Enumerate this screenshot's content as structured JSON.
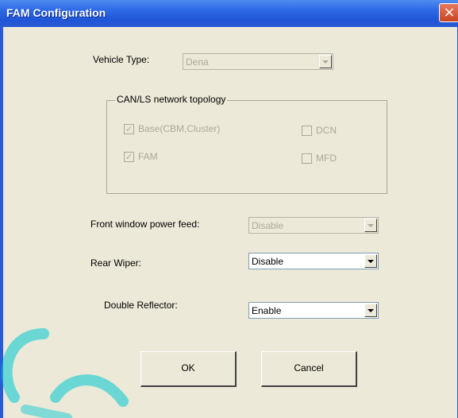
{
  "window": {
    "title": "FAM Configuration",
    "close_glyph": "×"
  },
  "vehicle_type": {
    "label": "Vehicle Type:",
    "value": "Dena"
  },
  "group": {
    "title": "CAN/LS network topology",
    "checks": [
      {
        "label": "Base(CBM,Cluster)",
        "checked": true
      },
      {
        "label": "FAM",
        "checked": true
      },
      {
        "label": "DCN",
        "checked": false
      },
      {
        "label": "MFD",
        "checked": false
      }
    ]
  },
  "front_window": {
    "label": "Front window power feed:",
    "value": "Disable"
  },
  "rear_wiper": {
    "label": "Rear Wiper:",
    "value": "Disable"
  },
  "double_reflector": {
    "label": "Double Reflector:",
    "value": "Enable"
  },
  "buttons": {
    "ok": "OK",
    "cancel": "Cancel"
  },
  "colors": {
    "title_bar": "#2a5ad6",
    "dialog_bg": "#ece9d8",
    "watermark": "#00c8d2"
  },
  "icons": {
    "check": "check-mark-icon",
    "dropdown": "chevron-down-icon",
    "close": "close-icon"
  }
}
